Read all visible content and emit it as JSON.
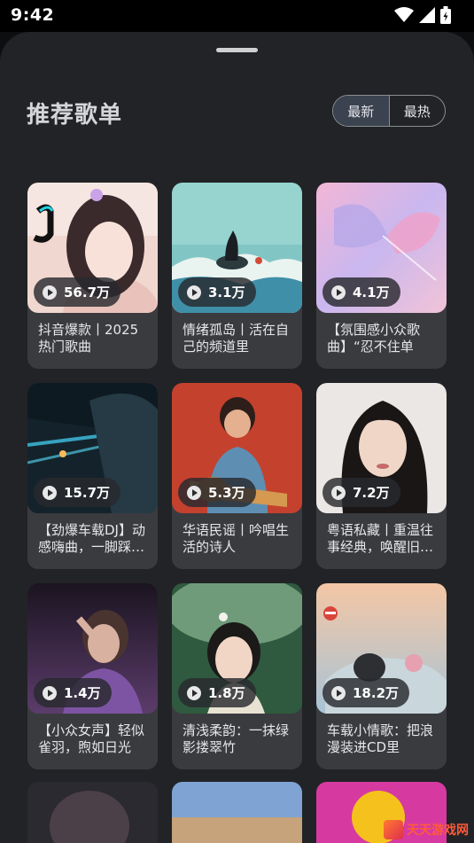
{
  "status_bar": {
    "time": "9:42"
  },
  "header": {
    "title": "推荐歌单"
  },
  "sort_toggle": {
    "newest": "最新",
    "hottest": "最热"
  },
  "playlists": [
    {
      "title": "抖音爆款丨2025热门歌曲",
      "plays": "56.7万"
    },
    {
      "title": "情绪孤岛丨活在自己的频道里",
      "plays": "3.1万"
    },
    {
      "title": "【氛围感小众歌曲】“忍不住单曲…",
      "plays": "4.1万"
    },
    {
      "title": "【劲爆车载DJ】动感嗨曲，一脚踩…",
      "plays": "15.7万"
    },
    {
      "title": "华语民谣丨吟唱生活的诗人",
      "plays": "5.3万"
    },
    {
      "title": "粤语私藏丨重温往事经典，唤醒旧…",
      "plays": "7.2万"
    },
    {
      "title": "【小众女声】轻似雀羽，煦如日光",
      "plays": "1.4万"
    },
    {
      "title": "清浅柔韵：一抹绿影搂翠竹",
      "plays": "1.8万"
    },
    {
      "title": "车载小情歌：把浪漫装进CD里",
      "plays": "18.2万"
    }
  ],
  "watermark": {
    "text": "天天游戏网"
  }
}
